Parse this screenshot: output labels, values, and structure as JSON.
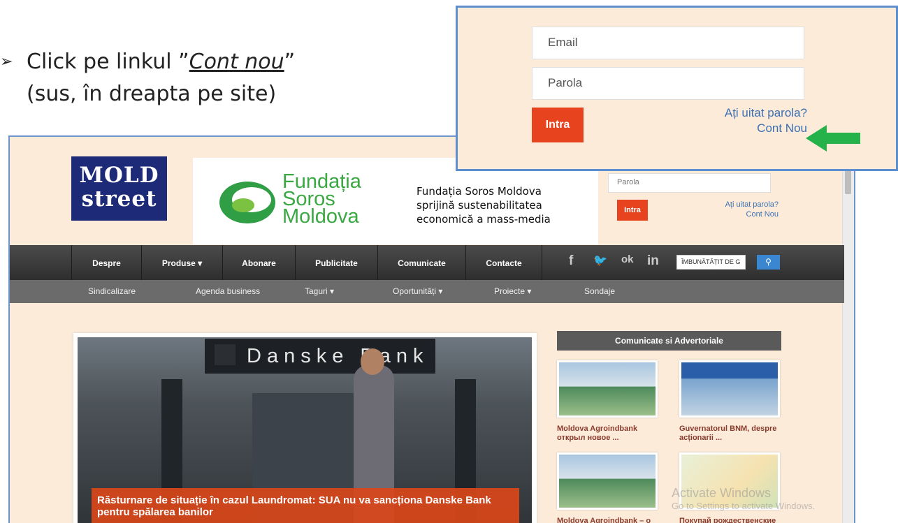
{
  "instruction": {
    "arrow": "➢",
    "text_before": "Click pe linkul ”",
    "link": "Cont nou",
    "text_after": "”",
    "line2": "(sus, în dreapta pe site)"
  },
  "site": {
    "logo": {
      "line1": "MOLD",
      "line2": "street"
    },
    "banner": {
      "fund_lines": [
        "Fundația",
        "Soros",
        "Moldova"
      ],
      "desc_lines": [
        "Fundația Soros Moldova",
        "sprijină sustenabilitatea",
        "economică a mass-media"
      ]
    },
    "login": {
      "password_placeholder": "Parola",
      "button": "Intra",
      "forgot": "Ați uitat parola?",
      "new_account": "Cont Nou"
    },
    "nav": {
      "items": [
        "Despre",
        "Produse ▾",
        "Abonare",
        "Publicitate",
        "Comunicate",
        "Contacte"
      ],
      "social": [
        "f",
        "🐦",
        "ok",
        "in"
      ],
      "search_value": "ÎMBUNĂTĂȚIT DE G"
    },
    "subnav": [
      "Sindicalizare",
      "Agenda business",
      "Taguri ▾",
      "Oportunități ▾",
      "Proiecte ▾",
      "Sondaje"
    ],
    "hero": {
      "sign": "Danske Bank",
      "caption_line1": "Răsturnare de situație în cazul Laundromat: SUA nu va sancționa Danske Bank",
      "caption_line2": "pentru spălarea banilor"
    },
    "sidebar": {
      "title": "Comunicate si Advertoriale",
      "cards": [
        {
          "title_1": "Moldova Agroindbank",
          "title_2": "открыл новое ..."
        },
        {
          "title_1": "Guvernatorul BNM, despre",
          "title_2": "acționarii ..."
        },
        {
          "title_1": "Moldova Agroindbank – o",
          "title_2": ""
        },
        {
          "title_1": "Покупай рождественские",
          "title_2": ""
        }
      ]
    },
    "watermark": {
      "line1": "Activate Windows",
      "line2": "Go to Settings to activate Windows."
    }
  },
  "callout": {
    "email_placeholder": "Email",
    "password_placeholder": "Parola",
    "button": "Intra",
    "forgot": "Ați uitat parola?",
    "new_account": "Cont Nou",
    "arrow_color": "#25b24a"
  }
}
